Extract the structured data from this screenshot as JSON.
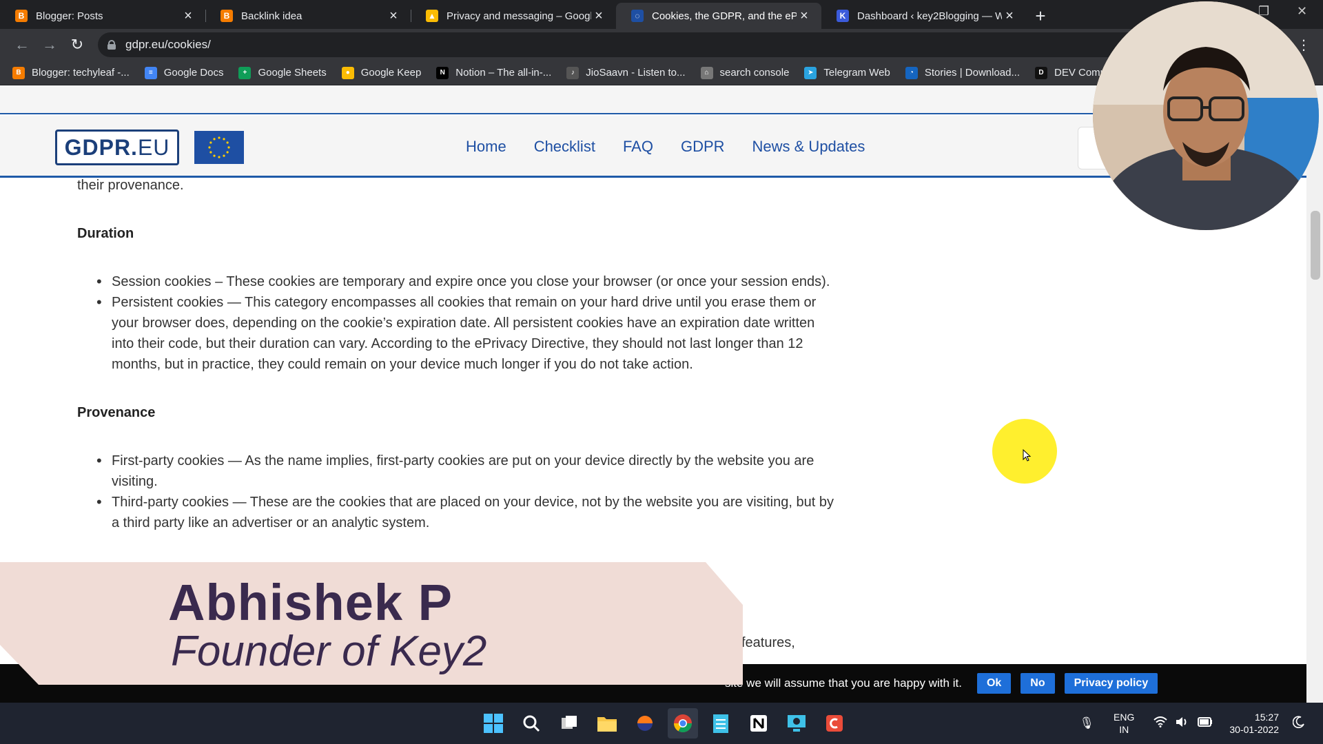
{
  "browser": {
    "tabs": [
      {
        "title": "Blogger: Posts",
        "favicon_color": "#f57c00",
        "favicon_glyph": "B",
        "active": false
      },
      {
        "title": "Backlink idea",
        "favicon_color": "#f57c00",
        "favicon_glyph": "B",
        "active": false
      },
      {
        "title": "Privacy and messaging – Google",
        "favicon_color": "#fbbc04",
        "favicon_glyph": "▲",
        "active": false
      },
      {
        "title": "Cookies, the GDPR, and the ePriv",
        "favicon_color": "#1e4fa3",
        "favicon_glyph": "◌",
        "active": true
      },
      {
        "title": "Dashboard ‹ key2Blogging — W",
        "favicon_color": "#3b5bdb",
        "favicon_glyph": "K",
        "active": false
      }
    ],
    "close_glyph": "×",
    "new_tab_glyph": "+",
    "url": "gdpr.eu/cookies/",
    "bookmarks": [
      {
        "label": "Blogger: techyleaf -...",
        "color": "#f57c00",
        "glyph": "B"
      },
      {
        "label": "Google Docs",
        "color": "#4285f4",
        "glyph": "≡"
      },
      {
        "label": "Google Sheets",
        "color": "#0f9d58",
        "glyph": "+"
      },
      {
        "label": "Google Keep",
        "color": "#fbbc04",
        "glyph": "●"
      },
      {
        "label": "Notion – The all-in-...",
        "color": "#000000",
        "glyph": "N"
      },
      {
        "label": "JioSaavn - Listen to...",
        "color": "#555555",
        "glyph": "♪"
      },
      {
        "label": "search console",
        "color": "#777777",
        "glyph": "⌂"
      },
      {
        "label": "Telegram Web",
        "color": "#2aa3e0",
        "glyph": "➤"
      },
      {
        "label": "Stories | Download...",
        "color": "#1565c0",
        "glyph": "◔"
      },
      {
        "label": "DEV Commu",
        "color": "#111111",
        "glyph": "D"
      }
    ]
  },
  "site": {
    "logo_text": "GDPR.",
    "logo_tld": "EU",
    "nav": [
      "Home",
      "Checklist",
      "FAQ",
      "GDPR",
      "News & Updates"
    ]
  },
  "article": {
    "lead_fragment": "their provenance.",
    "sections": [
      {
        "heading": "Duration",
        "items": [
          "Session cookies – These cookies are temporary and expire once you close your browser (or once your session ends).",
          "Persistent cookies — This category encompasses all cookies that remain on your hard drive until you erase them or your browser does, depending on the cookie’s expiration date. All persistent cookies have an expiration date written into their code, but their duration can vary. According to the ePrivacy Directive, they should not last longer than 12 months, but in practice, they could remain on your device much longer if you do not take action."
        ]
      },
      {
        "heading": "Provenance",
        "items": [
          "First-party cookies — As the name implies, first-party cookies are put on your device directly by the website you are visiting.",
          "Third-party cookies — These are the cookies that are placed on your device, not by the website you are visiting, but by a third party like an advertiser or an analytic system."
        ]
      }
    ],
    "partial_visible": "features,"
  },
  "cookie_bar": {
    "message": "site we will assume that you are happy with it.",
    "ok_label": "Ok",
    "no_label": "No",
    "policy_label": "Privacy policy"
  },
  "overlay": {
    "lower_third_name": "Abhishek P",
    "lower_third_title": "Founder of Key2"
  },
  "taskbar": {
    "language": "ENG",
    "region": "IN",
    "time": "15:27",
    "date": "30-01-2022"
  }
}
